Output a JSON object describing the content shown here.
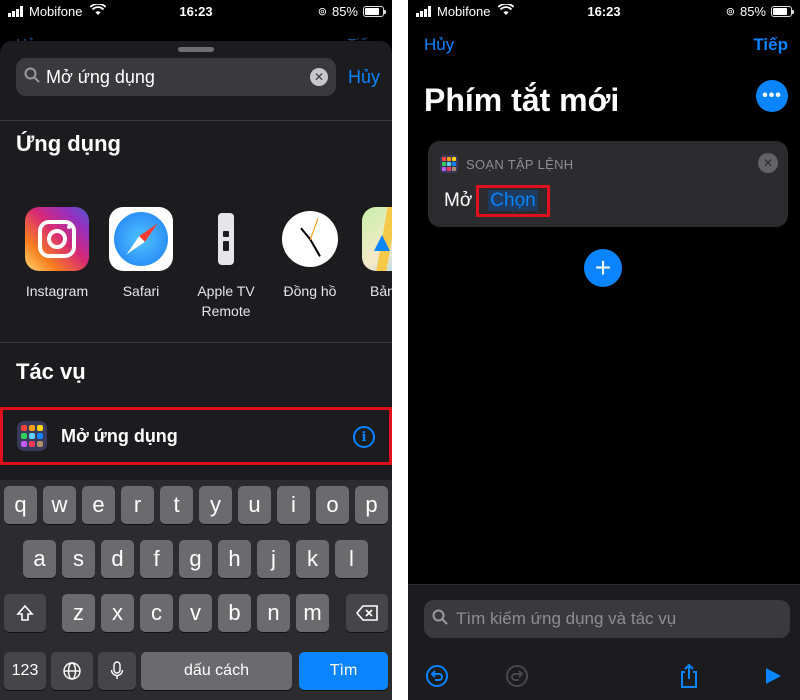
{
  "status_bar": {
    "carrier": "Mobifone",
    "time": "16:23",
    "battery": "85%",
    "battery_level": 0.85
  },
  "left": {
    "behind_cancel": "Hủy",
    "behind_next": "Tiếp",
    "search": {
      "value": "Mở ứng dụng",
      "cancel_label": "Hủy"
    },
    "apps_section_title": "Ứng dụng",
    "apps": [
      {
        "label": "Instagram",
        "icon": "instagram-icon"
      },
      {
        "label": "Safari",
        "icon": "safari-icon"
      },
      {
        "label": "Apple TV\nRemote",
        "icon": "apple-tv-remote-icon"
      },
      {
        "label": "Đồng hồ",
        "icon": "clock-icon"
      },
      {
        "label": "Bản",
        "icon": "maps-icon"
      }
    ],
    "actions_section_title": "Tác vụ",
    "action": {
      "label": "Mở ứng dụng",
      "icon": "app-grid-icon",
      "info_glyph": "i"
    },
    "keyboard": {
      "row1": [
        "q",
        "w",
        "e",
        "r",
        "t",
        "y",
        "u",
        "i",
        "o",
        "p"
      ],
      "row2": [
        "a",
        "s",
        "d",
        "f",
        "g",
        "h",
        "j",
        "k",
        "l"
      ],
      "row3": [
        "z",
        "x",
        "c",
        "v",
        "b",
        "n",
        "m"
      ],
      "numbers_key": "123",
      "space_key": "dấu cách",
      "return_key": "Tìm"
    }
  },
  "right": {
    "nav": {
      "cancel": "Hủy",
      "next": "Tiếp"
    },
    "title": "Phím tắt mới",
    "more_glyph": "•••",
    "card": {
      "caption": "SOẠN TẬP LỆNH",
      "verb": "Mở",
      "placeholder": "Chọn"
    },
    "bottom_search_placeholder": "Tìm kiếm ứng dụng và tác vụ"
  },
  "colors": {
    "accent": "#0a84ff",
    "highlight_border": "#e1101e",
    "background": "#000000",
    "sheet": "#1c1c1e"
  }
}
